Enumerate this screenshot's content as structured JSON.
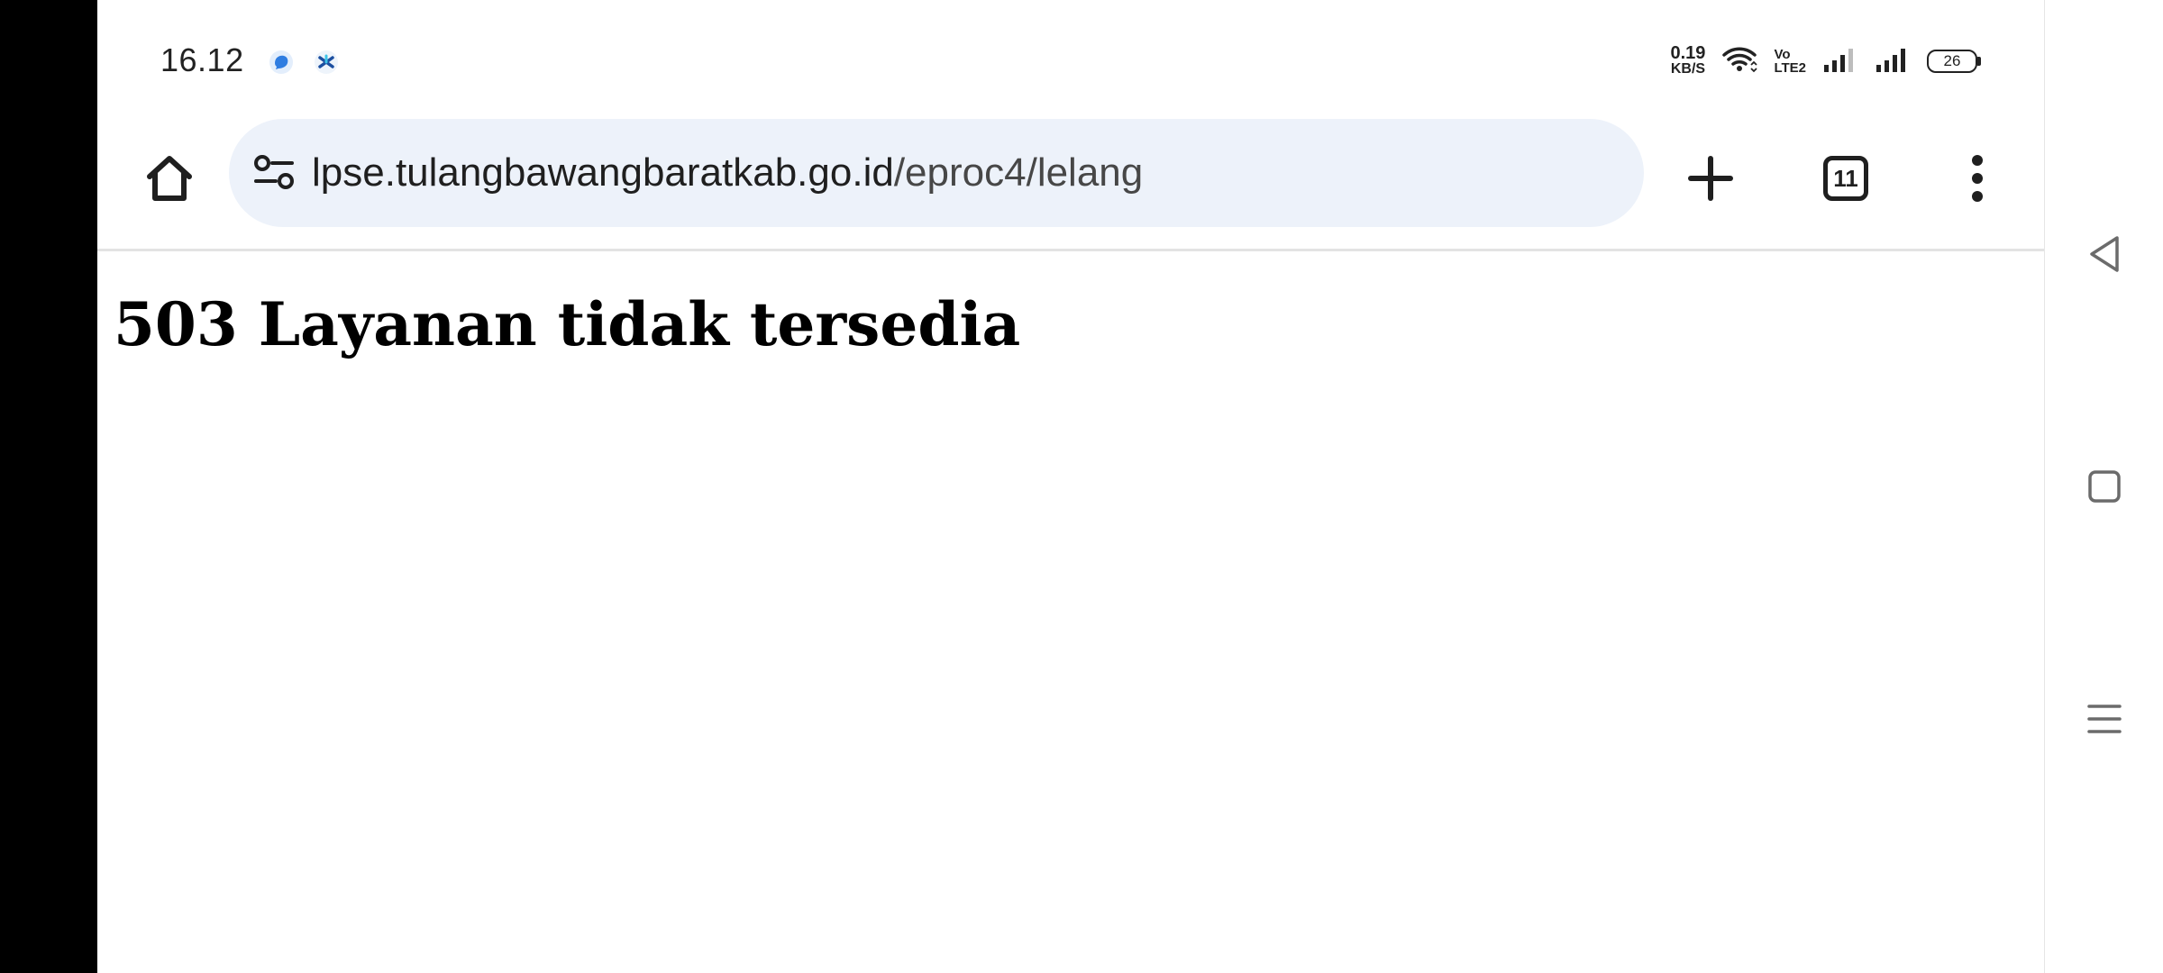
{
  "status_bar": {
    "time": "16.12",
    "net_speed_value": "0.19",
    "net_speed_unit": "KB/S",
    "volte_top": "Vo",
    "volte_bottom": "LTE2",
    "battery_level": "26",
    "icons": [
      "messenger-icon",
      "carrier-icon",
      "wifi-icon",
      "signal-icon",
      "signal-icon",
      "battery-icon"
    ]
  },
  "browser": {
    "url_host": "lpse.tulangbawangbaratkab.go.id",
    "url_path": "/eproc4/lelang",
    "tab_count": "11",
    "omnibox_bg": "#edf2fa"
  },
  "page": {
    "heading": "503 Layanan tidak tersedia"
  },
  "nav_bar": {
    "buttons": [
      "back-icon",
      "home-icon",
      "recents-icon"
    ]
  }
}
